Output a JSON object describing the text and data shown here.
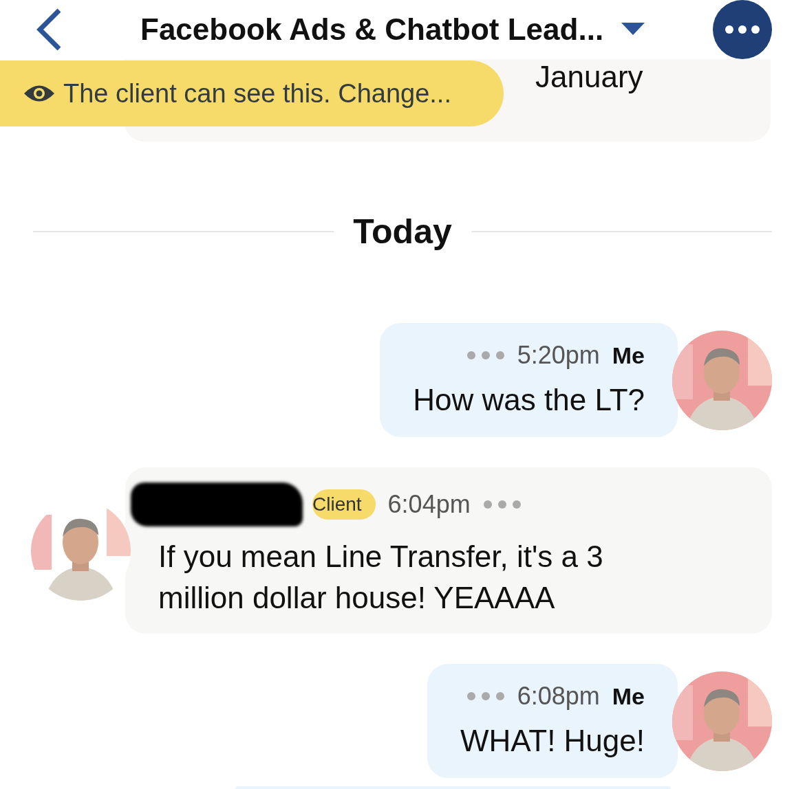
{
  "header": {
    "title": "Facebook Ads & Chatbot Lead..."
  },
  "previous_message": {
    "text": "January"
  },
  "visibility_banner": {
    "text": "The client can see this. Change..."
  },
  "day_divider": {
    "label": "Today"
  },
  "messages": [
    {
      "kind": "outgoing",
      "time": "5:20pm",
      "sender": "Me",
      "text": "How was the LT?"
    },
    {
      "kind": "incoming",
      "badge": "Client",
      "time": "6:04pm",
      "text": "If you mean Line Transfer, it's a 3 million dollar house! YEAAAA"
    },
    {
      "kind": "outgoing",
      "time": "6:08pm",
      "sender": "Me",
      "text": "WHAT! Huge!"
    }
  ]
}
